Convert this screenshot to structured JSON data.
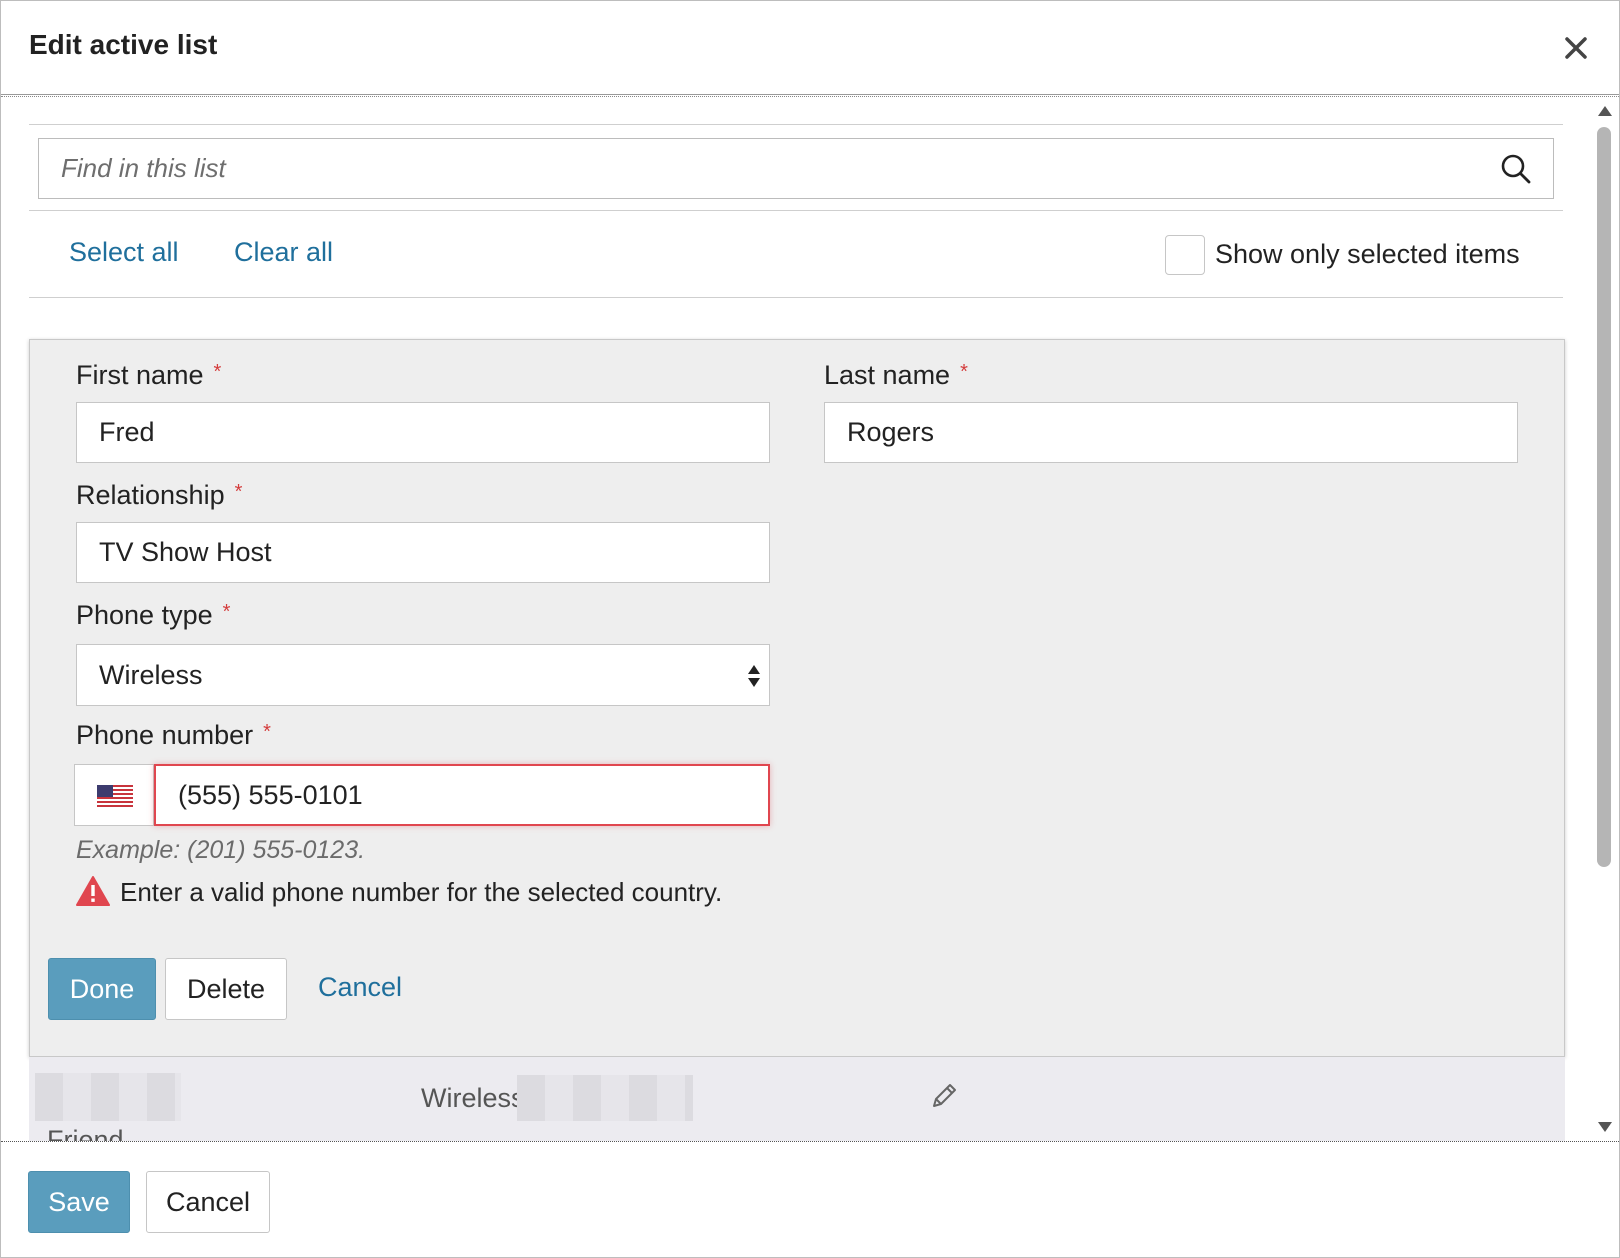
{
  "dialog": {
    "title": "Edit active list"
  },
  "search": {
    "placeholder": "Find in this list"
  },
  "toolbar": {
    "select_all": "Select all",
    "clear_all": "Clear all",
    "show_only_selected": "Show only selected items",
    "show_only_selected_checked": false
  },
  "form": {
    "first_name": {
      "label": "First name",
      "required_mark": "*",
      "value": "Fred"
    },
    "last_name": {
      "label": "Last name",
      "required_mark": "*",
      "value": "Rogers"
    },
    "relationship": {
      "label": "Relationship",
      "required_mark": "*",
      "value": "TV Show Host"
    },
    "phone_type": {
      "label": "Phone type",
      "required_mark": "*",
      "value": "Wireless"
    },
    "phone_number": {
      "label": "Phone number",
      "required_mark": "*",
      "country_flag": "us-flag-icon",
      "value": "(555) 555-0101",
      "hint": "Example: (201) 555-0123.",
      "error": "Enter a valid phone number for the selected country."
    },
    "buttons": {
      "done": "Done",
      "delete": "Delete",
      "cancel": "Cancel"
    }
  },
  "list_row": {
    "phone_type_label": "Wireless:",
    "relationship": "Friend"
  },
  "footer": {
    "save": "Save",
    "cancel": "Cancel"
  },
  "colors": {
    "link": "#1f6f9c",
    "primary_button": "#5a9dbd",
    "error": "#e0464f",
    "required": "#d43c3c",
    "panel_bg": "#eeeeee"
  }
}
